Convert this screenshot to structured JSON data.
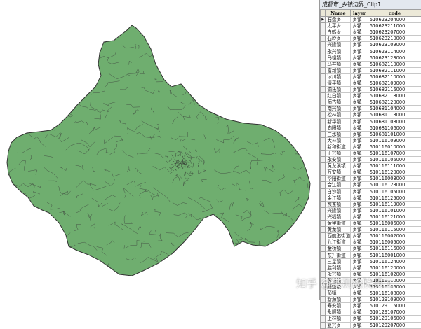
{
  "window": {
    "title": "成都市_乡镇边界_Clip1"
  },
  "map": {
    "fill_color": "#6fae6f",
    "stroke_color": "#333333"
  },
  "table": {
    "columns": [
      "Name",
      "layer",
      "code"
    ],
    "rows": [
      [
        "石盘乡",
        "乡镇",
        "510623204000"
      ],
      [
        "太平乡",
        "乡镇",
        "510623211000"
      ],
      [
        "白鹤乡",
        "乡镇",
        "510623207000"
      ],
      [
        "石岭乡",
        "乡镇",
        "510623210000"
      ],
      [
        "兴隆镇",
        "乡镇",
        "510623109000"
      ],
      [
        "永兴镇",
        "乡镇",
        "510623114000"
      ],
      [
        "马祖镇",
        "乡镇",
        "510623123000"
      ],
      [
        "马井镇",
        "乡镇",
        "510682110000"
      ],
      [
        "富新镇",
        "乡镇",
        "510682111000"
      ],
      [
        "冰川镇",
        "乡镇",
        "510682110000"
      ],
      [
        "清平镇",
        "乡镇",
        "510682109000"
      ],
      [
        "湔氐镇",
        "乡镇",
        "510682116000"
      ],
      [
        "红白镇",
        "乡镇",
        "510682118000"
      ],
      [
        "师古镇",
        "乡镇",
        "510682120000"
      ],
      [
        "南兴镇",
        "乡镇",
        "510681104000"
      ],
      [
        "松林镇",
        "乡镇",
        "510681113000"
      ],
      [
        "新华镇",
        "乡镇",
        "510681108000"
      ],
      [
        "向阳镇",
        "乡镇",
        "510681106000"
      ],
      [
        "三水镇",
        "乡镇",
        "510681101000"
      ],
      [
        "大林镇",
        "乡镇",
        "510116109000"
      ],
      [
        "新和街道",
        "乡镇",
        "510116010000"
      ],
      [
        "正兴镇",
        "乡镇",
        "510116107000"
      ],
      [
        "永安镇",
        "乡镇",
        "510116106000"
      ],
      [
        "黄龙溪镇",
        "乡镇",
        "510116111000"
      ],
      [
        "万安镇",
        "乡镇",
        "510116120000"
      ],
      [
        "华阳街道",
        "乡镇",
        "510116003000"
      ],
      [
        "合江镇",
        "乡镇",
        "510116123000"
      ],
      [
        "白沙镇",
        "乡镇",
        "510116105000"
      ],
      [
        "金江镇",
        "乡镇",
        "510116125000"
      ],
      [
        "煎茶镇",
        "乡镇",
        "510116119000"
      ],
      [
        "兴隆镇",
        "乡镇",
        "510116101000"
      ],
      [
        "兴福镇",
        "乡镇",
        "510116121000"
      ],
      [
        "黄甲街道",
        "乡镇",
        "510116006000"
      ],
      [
        "黄龙镇",
        "乡镇",
        "510116115000"
      ],
      [
        "西航港街道",
        "乡镇",
        "510116002000"
      ],
      [
        "九江街道",
        "乡镇",
        "510116005000"
      ],
      [
        "金桥镇",
        "乡镇",
        "510116116000"
      ],
      [
        "东升街道",
        "乡镇",
        "510116001000"
      ],
      [
        "三星镇",
        "乡镇",
        "510116124000"
      ],
      [
        "胜利镇",
        "乡镇",
        "510116120000"
      ],
      [
        "永兴镇",
        "乡镇",
        "510116102000"
      ],
      [
        "彭镇镇",
        "乡镇",
        "510116110000"
      ],
      [
        "籍田镇",
        "乡镇",
        "510116106000"
      ],
      [
        "彭镇",
        "乡镇",
        "510116108000"
      ],
      [
        "新源镇",
        "乡镇",
        "510129109000"
      ],
      [
        "寿安镇",
        "乡镇",
        "510129115000"
      ],
      [
        "永顺镇",
        "乡镇",
        "510129107000"
      ],
      [
        "上林镇",
        "乡镇",
        "510129106000"
      ],
      [
        "复兴乡",
        "乡镇",
        "510129207000"
      ]
    ]
  },
  "watermark": {
    "text": "知乎 @某测绘院员工"
  }
}
